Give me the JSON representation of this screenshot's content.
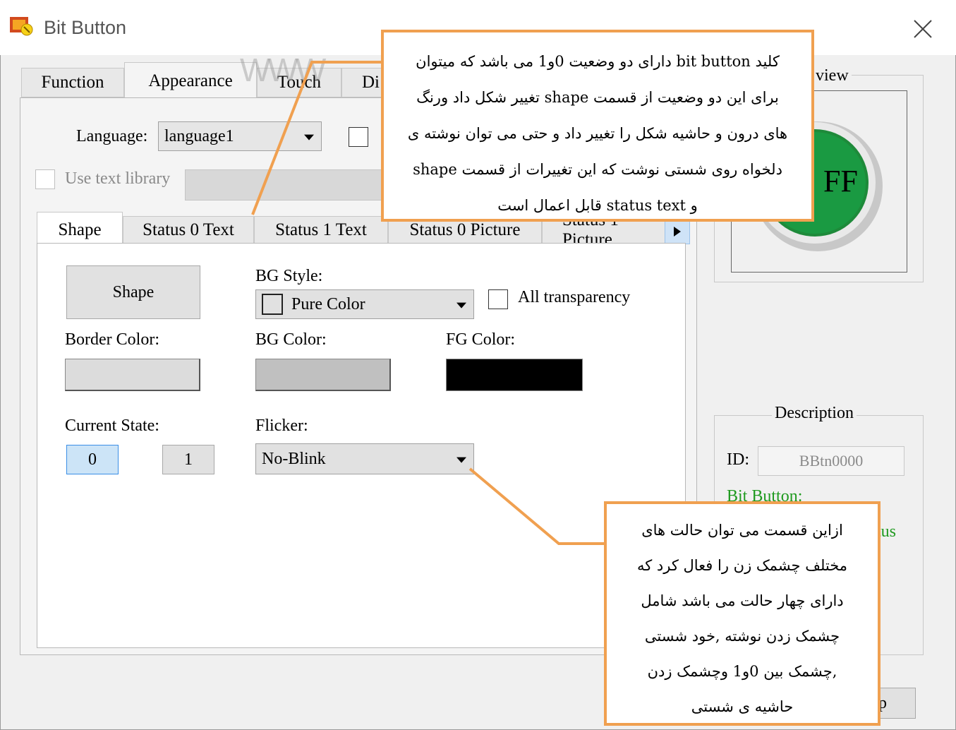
{
  "window": {
    "title": "Bit Button",
    "colors": {
      "callout_border": "#f0a050",
      "description_text": "#1f9a1f",
      "state0_bg": "#cce4f7",
      "state0_border": "#3a8ee6"
    }
  },
  "main_tabs": [
    {
      "label": "Function"
    },
    {
      "label": "Appearance"
    },
    {
      "label": "Touch"
    },
    {
      "label": "Di"
    }
  ],
  "watermark": "WWW",
  "language": {
    "label": "Language:",
    "value": "language1"
  },
  "use_text_library": {
    "label": "Use text library"
  },
  "sub_tabs": [
    {
      "label": "Shape"
    },
    {
      "label": "Status 0 Text"
    },
    {
      "label": "Status 1 Text"
    },
    {
      "label": "Status 0 Picture"
    },
    {
      "label": "Status 1 Picture"
    }
  ],
  "shape_panel": {
    "shape_button": "Shape",
    "bg_style": {
      "label": "BG Style:",
      "value": "Pure Color"
    },
    "all_transparency": {
      "label": "All transparency"
    },
    "border_color": {
      "label": "Border Color:",
      "color": "#dcdcdc"
    },
    "bg_color": {
      "label": "BG Color:",
      "color": "#c0c0c0"
    },
    "fg_color": {
      "label": "FG Color:",
      "color": "#000000"
    },
    "current_state": {
      "label": "Current State:",
      "states": [
        "0",
        "1"
      ],
      "selected": "0"
    },
    "flicker": {
      "label": "Flicker:",
      "value": "No-Blink"
    }
  },
  "preview": {
    "title": "view",
    "button_text": "FF",
    "button_color": "#1e8a3a"
  },
  "description": {
    "title": "Description",
    "id_label": "ID:",
    "id_value": "BBtn0000",
    "type_text": "Bit Button:",
    "type_suffix": "tus"
  },
  "bottom_button": {
    "label": "p"
  },
  "callouts": {
    "top": [
      "کلید bit button دارای دو وضعیت 0و1 می باشد که میتوان",
      "برای این دو وضعیت از قسمت shape تغییر شکل داد ورنگ",
      "های درون و حاشیه شکل را تغییر داد و حتی می توان نوشته ی",
      "دلخواه روی شستی نوشت که این تغییرات از قسمت shape",
      "و status text قابل اعمال است"
    ],
    "bottom": [
      "ازاین قسمت می توان حالت های",
      "مختلف چشمک زن را فعال کرد که",
      "دارای چهار حالت می باشد شامل",
      "چشمک زدن نوشته ,خود شستی",
      ",چشمک بین 0و1 وچشمک زدن",
      "حاشیه ی شستی"
    ]
  }
}
